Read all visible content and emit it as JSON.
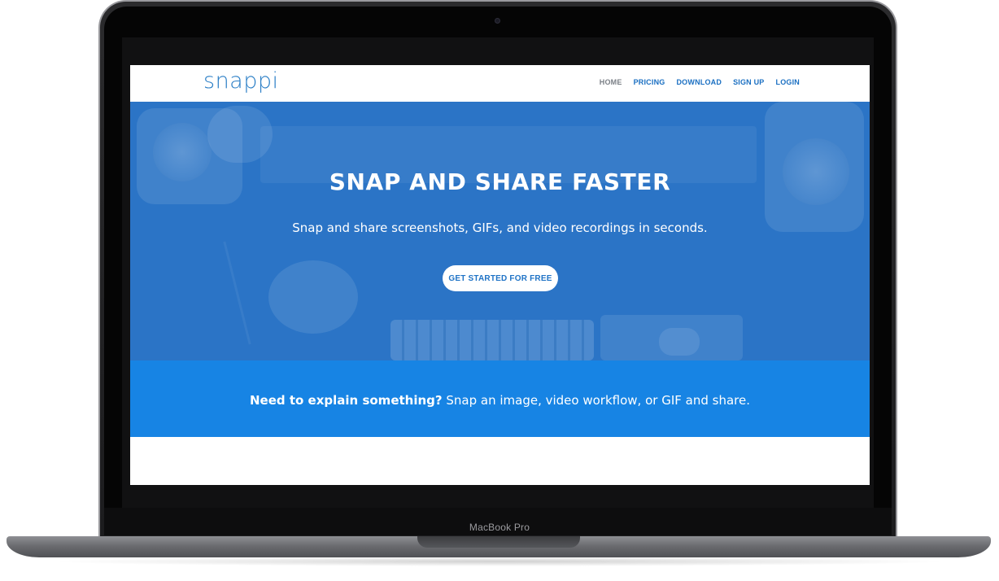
{
  "device": {
    "label": "MacBook Pro"
  },
  "site": {
    "logo": "snappi",
    "nav": {
      "items": [
        {
          "label": "HOME",
          "active": true
        },
        {
          "label": "PRICING",
          "active": false
        },
        {
          "label": "DOWNLOAD",
          "active": false
        },
        {
          "label": "SIGN UP",
          "active": false
        },
        {
          "label": "LOGIN",
          "active": false
        }
      ]
    },
    "hero": {
      "title": "SNAP AND SHARE FASTER",
      "subtitle": "Snap and share screenshots, GIFs, and video recordings in seconds.",
      "cta_label": "GET STARTED FOR FREE"
    },
    "band": {
      "bold": "Need to explain something?",
      "text": " Snap an image, video workflow, or GIF and share."
    }
  },
  "colors": {
    "brand_blue": "#2a7ec6",
    "hero_blue": "#2b74c6",
    "band_blue": "#1784e4",
    "nav_active": "#7a7f86"
  }
}
